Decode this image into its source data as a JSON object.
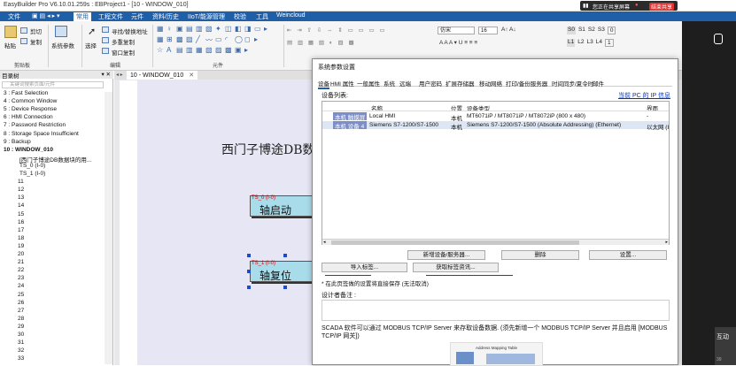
{
  "window": {
    "title": "EasyBuilder Pro V6.10.01.259s : EBProject1 - [10 - WINDOW_010]"
  },
  "share_bar": {
    "status": "您正在共享屏幕",
    "stop_label": "结束共享"
  },
  "menu": [
    "文件",
    "常用",
    "工程文件",
    "元件",
    "资料/历史",
    "IIoT/能源管理",
    "校验",
    "工具",
    "Weincloud"
  ],
  "ribbon": {
    "clipboard": {
      "paste": "粘贴",
      "cut": "剪切",
      "copy": "复制",
      "group": "剪贴板"
    },
    "system_params": "系统参数",
    "select": "选择",
    "edit": {
      "find_replace": "寻找/替换地址",
      "multi_copy": "多重复制",
      "window_copy": "窗口复制",
      "group": "编辑"
    },
    "elements_group": "元件",
    "font_name": "仿宋",
    "font_size": "16",
    "style_small": [
      "S0",
      "S1",
      "S2",
      "S3",
      "0"
    ],
    "style_large": [
      "L1",
      "L2",
      "L3",
      "L4",
      "1"
    ]
  },
  "tree": {
    "header": "目录树",
    "search_placeholder": "关键词搜索页面/元件",
    "items": [
      "3 : Fast Selection",
      "4 : Common Window",
      "5 : Device Response",
      "6 : HMI Connection",
      "7 : Password Restriction",
      "8 : Storage Space Insufficient",
      "9 : Backup",
      "10 : WINDOW_010",
      "[西门子博途DB数据块的用...",
      "TS_0 (I-0)",
      "TS_1 (I-0)",
      "11",
      "12",
      "13",
      "14",
      "15",
      "16",
      "17",
      "18",
      "19",
      "20",
      "21",
      "22",
      "23",
      "24",
      "25",
      "26",
      "27",
      "28",
      "29",
      "30",
      "31",
      "32",
      "33"
    ]
  },
  "editor": {
    "tab": "10 - WINDOW_010",
    "canvas_title": "西门子博途DB数据",
    "button1": {
      "tag": "TS_0 (I-0)",
      "label": "轴启动"
    },
    "button2": {
      "tag": "TS_1 (I-0)",
      "label": "轴复位"
    }
  },
  "dialog": {
    "title": "系统参数设置",
    "tabs": [
      "设备",
      "HMI 属性",
      "一般属性",
      "系统",
      "远端",
      "用户密码",
      "扩展存储器",
      "移动网络",
      "打印/备份服务器",
      "时间同步/夏令时",
      "邮件"
    ],
    "device_list_label": "设备列表:",
    "pc_info_link": "当前 PC 的 IP 信息",
    "columns": [
      "名称",
      "位置",
      "设备类型",
      "界面"
    ],
    "rows": [
      {
        "tag": "本机 触摸屏",
        "name": "Local HMI",
        "location": "本机",
        "type": "MT6071iP / MT8071iP / MT8072iP (800 x 480)",
        "interface": "-"
      },
      {
        "tag": "本机 设备 4",
        "name": "Siemens S7-1200/S7-1500",
        "location": "本机",
        "type": "Siemens S7-1200/S7-1500 (Absolute Addressing) (Ethernet)",
        "interface": "以太网 (I"
      }
    ],
    "buttons": {
      "new_device": "新增设备/服务器...",
      "delete": "删除",
      "settings": "设置...",
      "import_tags": "导入标签...",
      "get_tag_info": "获取标签资讯..."
    },
    "note": "* 在此页签做的设置将直接保存 (无法取消)",
    "designer_notes_label": "设计者备注 :",
    "scada_text": "SCADA 软件可以通过 MODBUS TCP/IP Server 来存取设备数据. (须先新增一个 MODBUS TCP/IP Server 并且启用 [MODBUS TCP/IP 网关])",
    "diagram_caption": "Address Mapping Table"
  },
  "side_panel": {
    "interact_label": "互动",
    "counter": "39"
  },
  "colors": {
    "menubar": "#1f5fa8",
    "selection": "#7b8ec7",
    "hmi_button": "#a8dceb",
    "link": "#0033cc"
  }
}
